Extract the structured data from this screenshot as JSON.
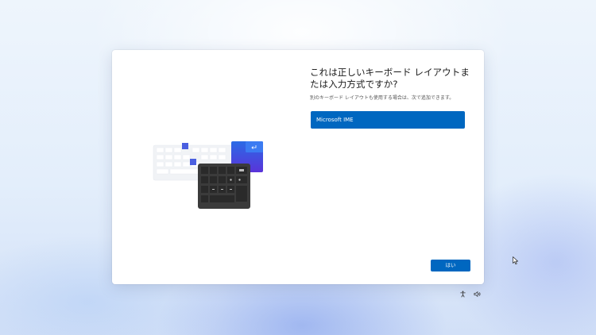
{
  "dialog": {
    "title": "これは正しいキーボード レイアウトまたは入力方式ですか?",
    "subtitle": "別のキーボード レイアウトも使用する場合は、次で追加できます。",
    "selected_layout": "Microsoft IME",
    "yes_label": "はい",
    "accent_color": "#0067c0",
    "illustration_icon": "keyboard-illustration"
  },
  "tray": {
    "icons": [
      "accessibility-icon",
      "volume-icon"
    ]
  },
  "cursor": "mouse-pointer"
}
